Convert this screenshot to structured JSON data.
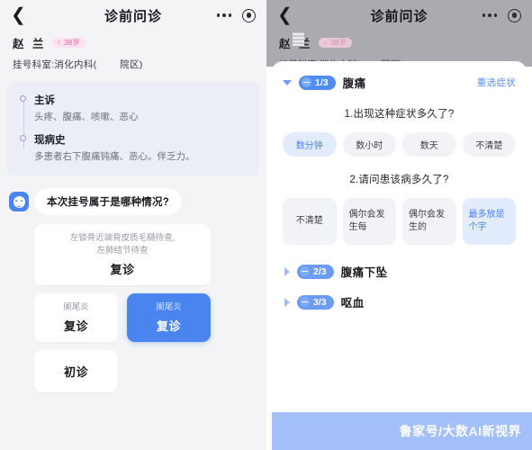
{
  "left": {
    "nav": {
      "back_icon": "chevron-left-icon",
      "title": "诊前问诊",
      "more_icon": "more-dots-icon",
      "target_icon": "target-circle-icon"
    },
    "patient": {
      "name": "赵 兰",
      "gender_symbol": "♀",
      "age_label": "38岁",
      "department": "挂号科室:消化内科(        院区)"
    },
    "summary": {
      "items": [
        {
          "title": "主诉",
          "text": "头疼、腹痛、咳嗽、恶心"
        },
        {
          "title": "现病史",
          "text": "多患者右下腹痛钝痛、恶心。伴乏力。"
        }
      ]
    },
    "chat": {
      "avatar_icon": "robot-face-icon",
      "question": "本次挂号属于是哪种情况?"
    },
    "options": {
      "wide": {
        "sub": "左锁骨近端骨皮质毛糙待查,\n左肺结节待查",
        "main": "复诊"
      },
      "pair": [
        {
          "sub": "阑尾炎",
          "main": "复诊",
          "selected": false
        },
        {
          "sub": "阑尾炎",
          "main": "复诊",
          "selected": true
        }
      ],
      "single": {
        "main": "初诊"
      }
    }
  },
  "right": {
    "nav": {
      "back_icon": "chevron-left-icon",
      "title": "诊前问诊",
      "more_icon": "more-dots-icon",
      "target_icon": "target-circle-icon"
    },
    "patient": {
      "name": "赵 兰",
      "gender_symbol": "♀",
      "age_label": "38岁",
      "department": "挂号科室:消化内科(        院区)"
    },
    "sheet": {
      "expanded": {
        "counter": "1/3",
        "symptom": "腹痛",
        "reselect_label": "重选症状",
        "collapse_icon": "triangle-down-icon",
        "minus_icon": "minus-circle-icon"
      },
      "questions": [
        {
          "text": "1.出现这种症状多久了?",
          "style": "pill",
          "options": [
            {
              "label": "数分钟",
              "selected": true
            },
            {
              "label": "数小时",
              "selected": false
            },
            {
              "label": "数天",
              "selected": false
            },
            {
              "label": "不清楚",
              "selected": false
            }
          ]
        },
        {
          "text": "2.请问患该病多久了?",
          "style": "box",
          "options": [
            {
              "label": "不清楚",
              "selected": false,
              "align": "center"
            },
            {
              "label": "偶尔会发生每",
              "selected": false,
              "align": "left"
            },
            {
              "label": "偶尔会发生的",
              "selected": false,
              "align": "left"
            },
            {
              "label": "最多放是个字",
              "selected": true,
              "align": "left"
            }
          ]
        }
      ],
      "collapsed": [
        {
          "counter": "2/3",
          "symptom": "腹痛下坠",
          "expand_icon": "triangle-right-icon"
        },
        {
          "counter": "3/3",
          "symptom": "呕血",
          "expand_icon": "triangle-right-icon"
        }
      ]
    },
    "watermark": {
      "text": "鲁家号/大数AI新视界"
    }
  },
  "colors": {
    "accent_blue": "#4a84ef",
    "chip_selected_bg": "#e3ecfd",
    "badge_pink": "#fde3ef",
    "summary_bg": "#eceef7",
    "left_bg": "#f4f4f6",
    "watermark_bg": "#a4c0fa"
  }
}
